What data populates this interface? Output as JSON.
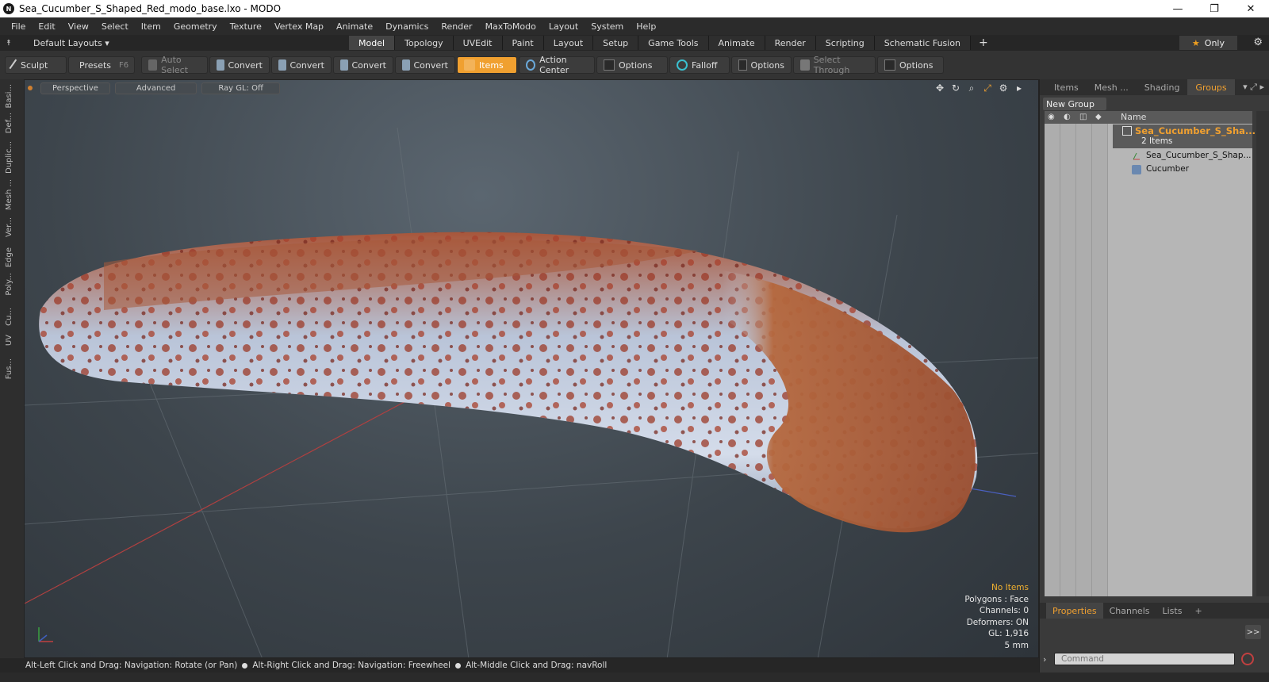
{
  "window": {
    "title": "Sea_Cucumber_S_Shaped_Red_modo_base.lxo - MODO",
    "app_icon": "N",
    "minimize": "—",
    "restore": "❐",
    "close": "✕"
  },
  "menu": [
    "File",
    "Edit",
    "View",
    "Select",
    "Item",
    "Geometry",
    "Texture",
    "Vertex Map",
    "Animate",
    "Dynamics",
    "Render",
    "MaxToModo",
    "Layout",
    "System",
    "Help"
  ],
  "layouts": {
    "label": "Default Layouts ▾",
    "tabs": [
      "Model",
      "Topology",
      "UVEdit",
      "Paint",
      "Layout",
      "Setup",
      "Game Tools",
      "Animate",
      "Render",
      "Scripting",
      "Schematic Fusion"
    ],
    "active_tab": "Model",
    "add": "+",
    "only": "Only"
  },
  "toolbar": {
    "sculpt": "Sculpt",
    "presets": "Presets",
    "presets_key": "F6",
    "auto_select": "Auto Select",
    "convert1": "Convert",
    "convert2": "Convert",
    "convert3": "Convert",
    "convert4": "Convert",
    "items": "Items",
    "action_center": "Action Center",
    "options1": "Options",
    "falloff": "Falloff",
    "options2": "Options",
    "select_through": "Select Through",
    "options3": "Options"
  },
  "left_tabs": [
    "Basi...",
    "Def...",
    "Duplic...",
    "Mesh ...",
    "Ver...",
    "Edge",
    "Poly...",
    "Cu...",
    "UV",
    "Fus..."
  ],
  "viewport": {
    "view": "Perspective",
    "advanced": "Advanced",
    "raygl": "Ray GL: Off",
    "info": {
      "selection": "No Items",
      "polygons": "Polygons : Face",
      "channels": "Channels: 0",
      "deformers": "Deformers: ON",
      "gl": "GL: 1,916",
      "scale": "5 mm"
    }
  },
  "status": {
    "hint1": "Alt-Left Click and Drag: Navigation: Rotate (or Pan)",
    "hint2": "Alt-Right Click and Drag: Navigation: Freewheel",
    "hint3": "Alt-Middle Click and Drag: navRoll"
  },
  "groups_panel": {
    "tabs": [
      "Items",
      "Mesh ...",
      "Shading",
      "Groups"
    ],
    "active_tab": "Groups",
    "new_group": "New Group",
    "name_header": "Name",
    "group_name": "Sea_Cucumber_S_Sha...",
    "group_count": "2 Items",
    "children": [
      "Sea_Cucumber_S_Shap...",
      "Cucumber"
    ]
  },
  "properties_panel": {
    "tabs": [
      "Properties",
      "Channels",
      "Lists"
    ],
    "active_tab": "Properties",
    "add": "+",
    "expand": ">>",
    "command_placeholder": "Command"
  },
  "colors": {
    "accent": "#f0a030",
    "viewport_bg": "#3d454c"
  }
}
